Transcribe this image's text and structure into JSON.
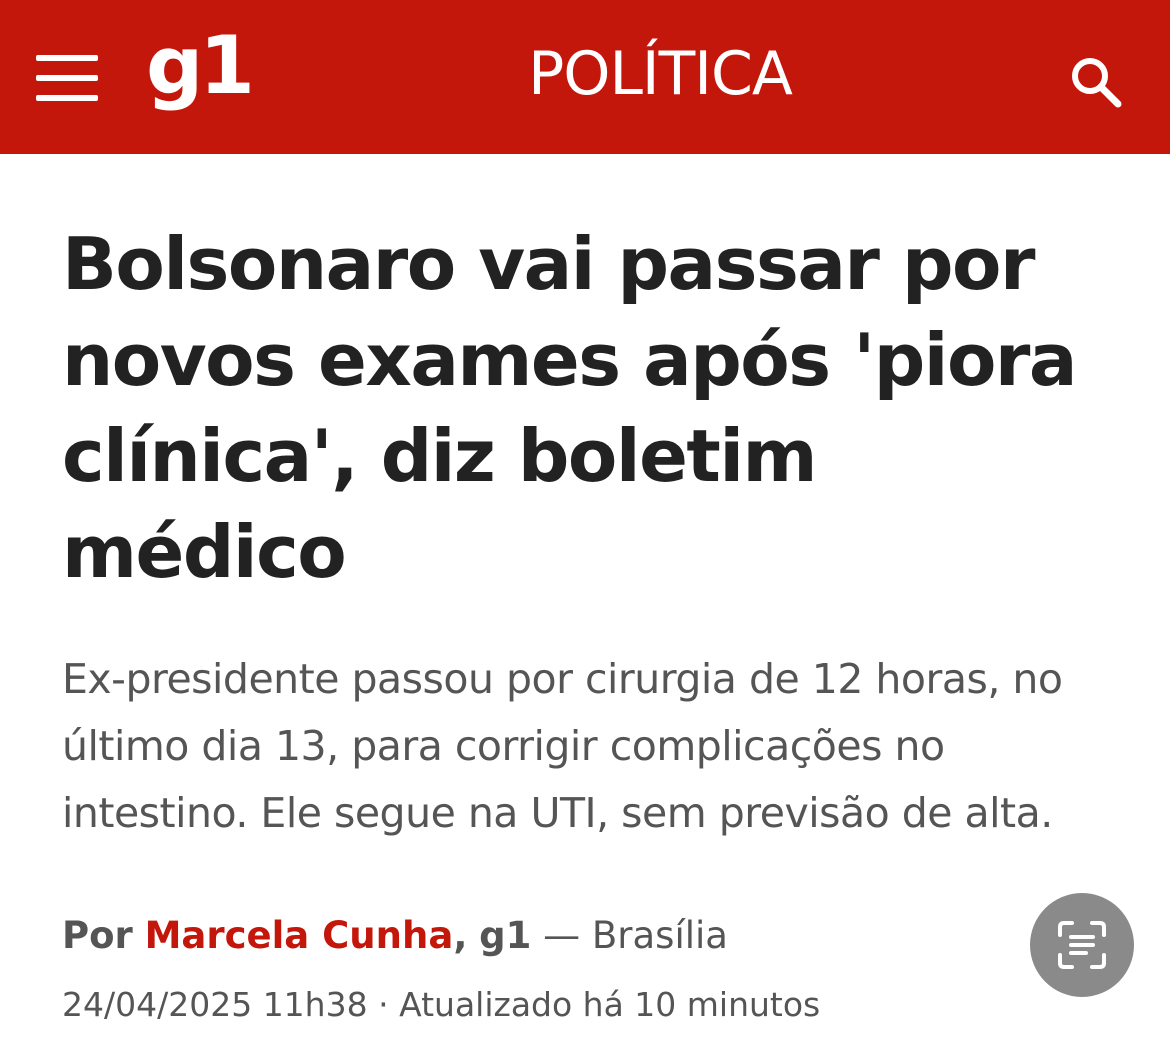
{
  "header": {
    "background_color": "#c4170c",
    "menu_icon": "hamburger-menu-icon",
    "logo_text": "g1",
    "section_title": "POLÍTICA",
    "search_icon": "search-icon"
  },
  "article": {
    "headline": "Bolsonaro vai passar por novos exames após 'piora clínica', diz boletim médico",
    "subtitle": "Ex-presidente passou por cirurgia de 12 horas, no último dia 13, para corrigir complicações no intestino. Ele segue na UTI, sem previsão de alta.",
    "byline": {
      "prefix": "Por",
      "author": "Marcela Cunha",
      "separator": ",",
      "outlet": "g1",
      "location_separator": "—",
      "location": "Brasília"
    },
    "published": "24/04/2025 11h38",
    "dot_separator": "·",
    "updated": "Atualizado há 10 minutos"
  },
  "floating_button": {
    "icon": "text-scan-icon",
    "color": "#8a8a8a"
  },
  "colors": {
    "accent": "#c4170c",
    "headline_text": "#222222",
    "body_text": "#555555"
  }
}
